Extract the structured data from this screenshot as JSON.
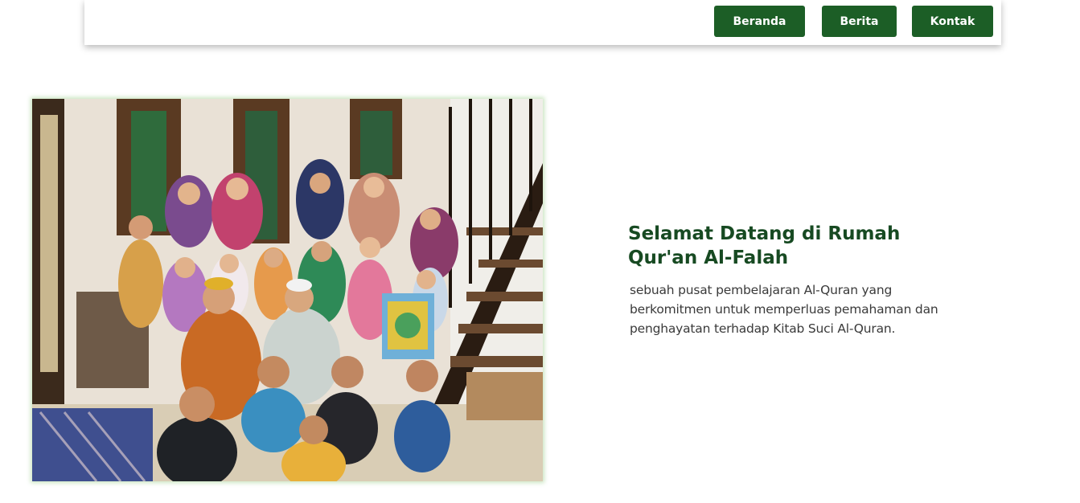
{
  "nav": {
    "items": [
      {
        "label": "Beranda"
      },
      {
        "label": "Berita"
      },
      {
        "label": "Kontak"
      }
    ],
    "accent_color": "#1c5e26"
  },
  "hero": {
    "image_alt": "Foto bersama santri Rumah Qur'an Al-Falah",
    "title": "Selamat Datang di Rumah Qur'an Al-Falah",
    "description": "sebuah pusat pembelajaran Al-Quran yang berkomitmen untuk memperluas pemahaman dan penghayatan terhadap Kitab Suci Al-Quran.",
    "title_color": "#174a22"
  }
}
